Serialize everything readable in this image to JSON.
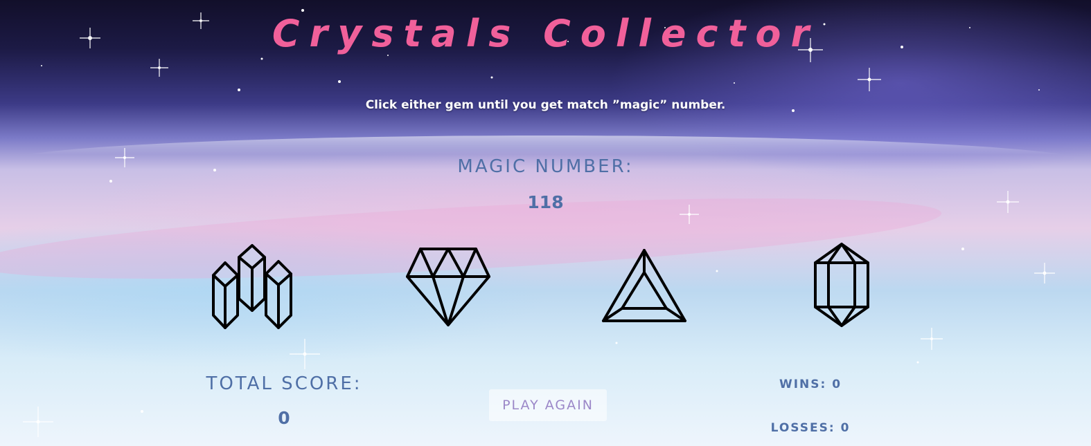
{
  "header": {
    "title": "Crystals Collector",
    "instructions": "Click either gem until you get match ”magic” number."
  },
  "magic": {
    "label": "MAGIC NUMBER:",
    "value": "118"
  },
  "gems": [
    {
      "name": "crystal-cluster"
    },
    {
      "name": "diamond"
    },
    {
      "name": "triangle-gem"
    },
    {
      "name": "hexagonal-crystal"
    }
  ],
  "score": {
    "label": "TOTAL SCORE:",
    "value": "0"
  },
  "controls": {
    "play_again_label": "PLAY AGAIN"
  },
  "stats": {
    "wins_text": "WINS: 0",
    "losses_text": "LOSSES: 0"
  },
  "colors": {
    "title": "#f0609a",
    "text": "#4f6fa6",
    "button_text": "#9b87c8"
  }
}
